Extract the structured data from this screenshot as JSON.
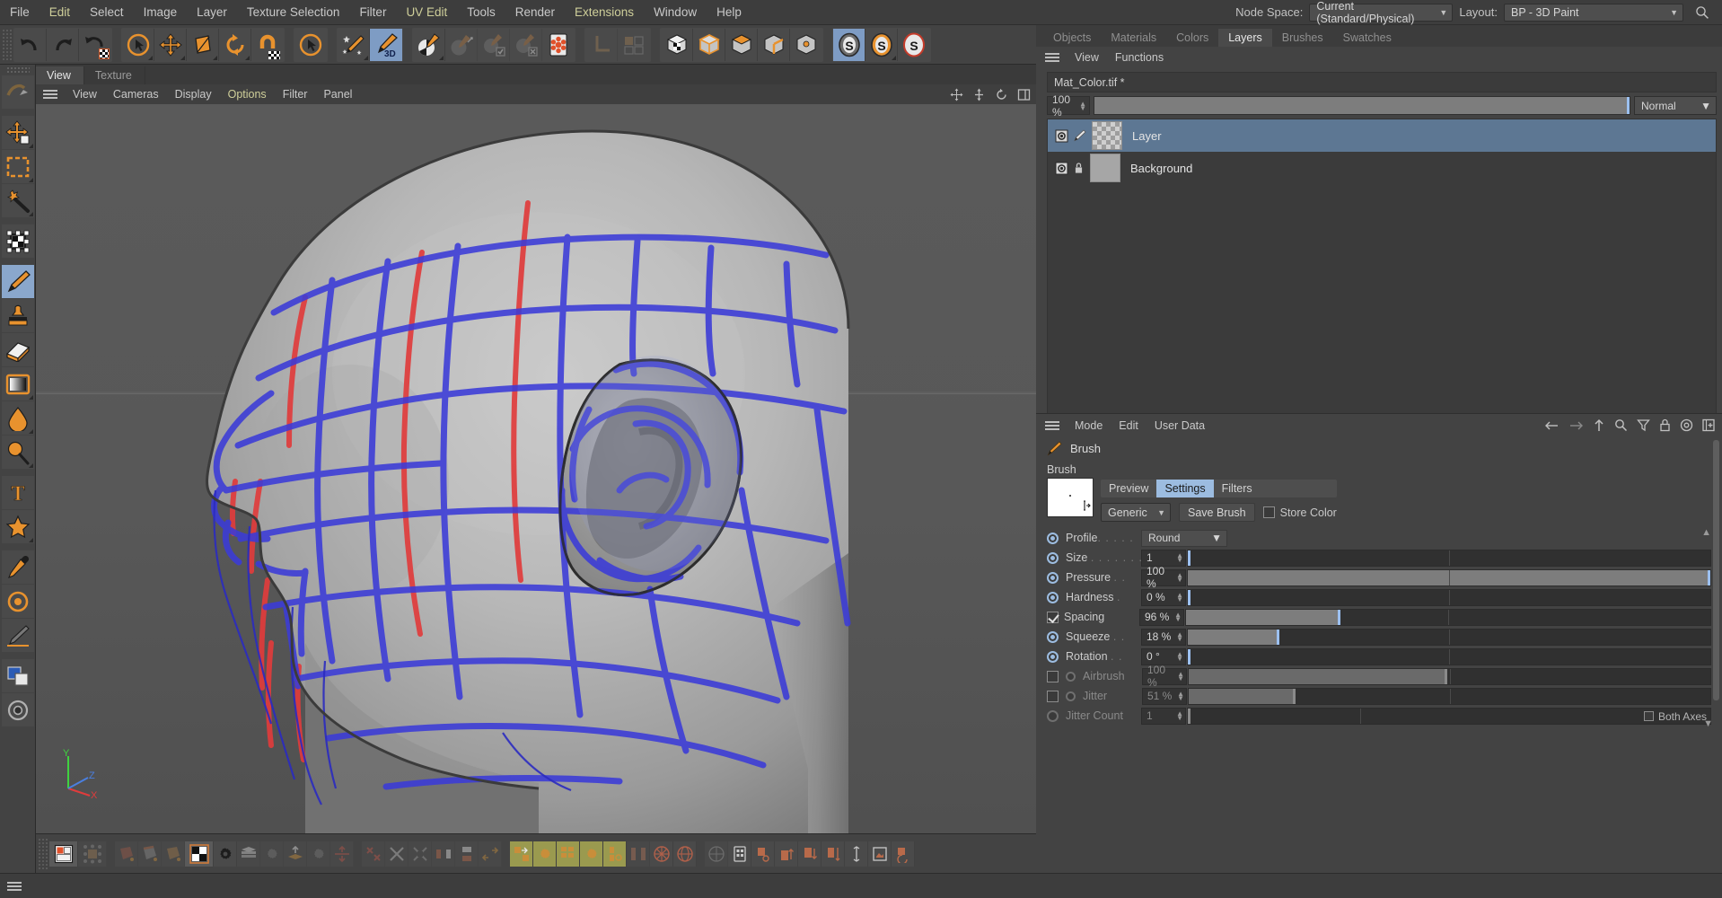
{
  "app": {
    "title": "BodyPaint 3D / Cinema 4D"
  },
  "menubar": {
    "items": [
      {
        "label": "File",
        "highlight": false
      },
      {
        "label": "Edit",
        "highlight": true
      },
      {
        "label": "Select",
        "highlight": false
      },
      {
        "label": "Image",
        "highlight": false
      },
      {
        "label": "Layer",
        "highlight": false
      },
      {
        "label": "Texture Selection",
        "highlight": false
      },
      {
        "label": "Filter",
        "highlight": false
      },
      {
        "label": "UV Edit",
        "highlight": true
      },
      {
        "label": "Tools",
        "highlight": false
      },
      {
        "label": "Render",
        "highlight": false
      },
      {
        "label": "Extensions",
        "highlight": true
      },
      {
        "label": "Window",
        "highlight": false
      },
      {
        "label": "Help",
        "highlight": false
      }
    ],
    "node_space_label": "Node Space:",
    "node_space_value": "Current (Standard/Physical)",
    "layout_label": "Layout:",
    "layout_value": "BP - 3D Paint",
    "search_icon": "search-icon"
  },
  "toolbar": {
    "groups": [
      {
        "name": "undo-redo-group",
        "buttons": [
          {
            "name": "undo-button",
            "icon": "undo-arrow-icon",
            "state": "normal"
          },
          {
            "name": "redo-button",
            "icon": "redo-arrow-icon",
            "state": "normal"
          },
          {
            "name": "undo-texture-button",
            "icon": "undo-texture-icon",
            "state": "normal"
          }
        ]
      },
      {
        "name": "transform-group",
        "buttons": [
          {
            "name": "selection-tool-button",
            "icon": "cursor-circle-icon",
            "state": "normal"
          },
          {
            "name": "move-tool-button",
            "icon": "move-cross-icon",
            "state": "normal"
          },
          {
            "name": "scale-tool-button",
            "icon": "scale-box-icon",
            "state": "normal"
          },
          {
            "name": "rotate-tool-button",
            "icon": "rotate-circle-icon",
            "state": "normal"
          },
          {
            "name": "snap-button",
            "icon": "magnet-icon",
            "state": "normal"
          }
        ]
      },
      {
        "name": "uv-group",
        "buttons": [
          {
            "name": "uv-selection-button",
            "icon": "cursor-circle-icon",
            "state": "normal"
          }
        ]
      },
      {
        "name": "paint-group",
        "buttons": [
          {
            "name": "paint-setup-wizard-button",
            "icon": "brush-stars-icon",
            "state": "normal"
          },
          {
            "name": "paint-3d-toggle-button",
            "icon": "brush-3d-icon",
            "state": "active"
          }
        ]
      },
      {
        "name": "texture-group",
        "buttons": [
          {
            "name": "texture-paint-button",
            "icon": "sphere-brush-icon",
            "state": "normal"
          },
          {
            "name": "projection-paint-button",
            "icon": "sphere-arrow-icon",
            "state": "disabled"
          },
          {
            "name": "apply-projection-button",
            "icon": "sphere-check-icon",
            "state": "disabled"
          },
          {
            "name": "cancel-projection-button",
            "icon": "sphere-x-icon",
            "state": "disabled"
          },
          {
            "name": "symmetry-button",
            "icon": "snowflake-icon",
            "state": "normal"
          }
        ]
      },
      {
        "name": "axis-group",
        "buttons": [
          {
            "name": "axis-button",
            "icon": "axis-L-icon",
            "state": "disabled"
          },
          {
            "name": "layout-button",
            "icon": "layout-squares-icon",
            "state": "disabled"
          }
        ]
      },
      {
        "name": "mode-group",
        "buttons": [
          {
            "name": "texture-mode-button",
            "icon": "cube-checker-icon",
            "state": "normal"
          },
          {
            "name": "model-mode-button",
            "icon": "cube-outline-icon",
            "state": "normal"
          },
          {
            "name": "polygon-mode-button",
            "icon": "cube-top-icon",
            "state": "normal"
          },
          {
            "name": "edge-mode-button",
            "icon": "cube-edge-icon",
            "state": "normal"
          },
          {
            "name": "point-mode-button",
            "icon": "cube-point-icon",
            "state": "normal"
          }
        ]
      },
      {
        "name": "cineman-group",
        "buttons": [
          {
            "name": "cineman-grey-button",
            "icon": "cineman-grey-icon",
            "state": "active"
          },
          {
            "name": "cineman-orange-button",
            "icon": "cineman-orange-icon",
            "state": "normal"
          },
          {
            "name": "cineman-red-button",
            "icon": "cineman-red-icon",
            "state": "normal"
          }
        ]
      }
    ]
  },
  "left_toolbar": {
    "buttons": [
      {
        "name": "tool-live-selection",
        "icon": "live-selection-icon",
        "state": "normal"
      },
      {
        "name": "tool-move",
        "icon": "move-arrows-icon",
        "state": "normal"
      },
      {
        "name": "tool-rect-selection",
        "icon": "rect-marquee-icon",
        "state": "normal"
      },
      {
        "name": "tool-magic-wand",
        "icon": "magic-wand-icon",
        "state": "normal"
      },
      {
        "name": "tool-texture-transform",
        "icon": "texture-transform-icon",
        "state": "normal"
      },
      {
        "name": "tool-brush",
        "icon": "paint-brush-icon",
        "state": "active"
      },
      {
        "name": "tool-clone",
        "icon": "clone-stamp-icon",
        "state": "normal"
      },
      {
        "name": "tool-eraser",
        "icon": "eraser-icon",
        "state": "normal"
      },
      {
        "name": "tool-gradient",
        "icon": "gradient-icon",
        "state": "normal"
      },
      {
        "name": "tool-fill",
        "icon": "fill-drop-icon",
        "state": "normal"
      },
      {
        "name": "tool-blur",
        "icon": "blur-magnifier-icon",
        "state": "normal"
      },
      {
        "name": "tool-text",
        "icon": "text-T-icon",
        "state": "normal"
      },
      {
        "name": "tool-shape",
        "icon": "star-shape-icon",
        "state": "normal"
      },
      {
        "name": "tool-color-picker",
        "icon": "eyedropper-icon",
        "state": "normal"
      },
      {
        "name": "tool-color-wheel",
        "icon": "color-wheel-icon",
        "state": "normal"
      },
      {
        "name": "tool-line",
        "icon": "line-pen-icon",
        "state": "normal"
      },
      {
        "name": "tool-swatch",
        "icon": "fg-bg-color-icon",
        "state": "normal"
      },
      {
        "name": "tool-fill-mode",
        "icon": "circle-mode-icon",
        "state": "normal"
      }
    ]
  },
  "viewport": {
    "tabs": [
      {
        "label": "View",
        "selected": true
      },
      {
        "label": "Texture",
        "selected": false
      }
    ],
    "menus": [
      {
        "label": "View",
        "highlight": false
      },
      {
        "label": "Cameras",
        "highlight": false
      },
      {
        "label": "Display",
        "highlight": false
      },
      {
        "label": "Options",
        "highlight": true
      },
      {
        "label": "Filter",
        "highlight": false
      },
      {
        "label": "Panel",
        "highlight": false
      }
    ],
    "right_icons": [
      {
        "name": "pan-icon"
      },
      {
        "name": "dolly-icon"
      },
      {
        "name": "rotate-view-icon"
      },
      {
        "name": "maximize-view-icon"
      }
    ],
    "axis_gizmo": {
      "x": "X",
      "y": "Y",
      "z": "Z"
    },
    "content_description": "3D head model in side view with blue and red UV wireframe overlay"
  },
  "bottom_toolbar": {
    "groups": [
      {
        "name": "display-group",
        "buttons": [
          {
            "name": "uv-mesh-display-button",
            "icon": "uv-display-icon",
            "state": "sel"
          },
          {
            "name": "uv-mesh-edit-button",
            "icon": "uv-edit-icon",
            "state": "dis"
          }
        ]
      },
      {
        "name": "paint-mode-group",
        "buttons": [
          {
            "name": "paint-polygon-button",
            "icon": "paint-poly-icon",
            "state": "dis"
          },
          {
            "name": "paint-edge-button",
            "icon": "paint-edge-icon",
            "state": "dis"
          },
          {
            "name": "paint-point-button",
            "icon": "paint-point-icon",
            "state": "dis"
          },
          {
            "name": "uv-checker-button",
            "icon": "uv-checker-icon",
            "state": "sel"
          },
          {
            "name": "uv-checker-settings-button",
            "icon": "gear-icon",
            "state": "normal"
          },
          {
            "name": "uv-layers-button",
            "icon": "uv-layers-icon",
            "state": "dis"
          },
          {
            "name": "uv-layers-settings-button",
            "icon": "gear-icon",
            "state": "dis"
          },
          {
            "name": "uv-unfold-button",
            "icon": "uv-unfold-icon",
            "state": "dis"
          },
          {
            "name": "uv-unfold-settings-button",
            "icon": "gear-icon",
            "state": "dis"
          },
          {
            "name": "uv-align-button",
            "icon": "uv-align-icon",
            "state": "dis"
          }
        ]
      },
      {
        "name": "uv-command-group",
        "buttons": [
          {
            "name": "uv-flip-button",
            "icon": "uv-flip-icon",
            "state": "dis"
          },
          {
            "name": "uv-transfer-button",
            "icon": "uv-transfer-icon",
            "state": "dis"
          },
          {
            "name": "uv-copy-button",
            "icon": "uv-copy-icon",
            "state": "dis"
          },
          {
            "name": "uv-mirror-u-button",
            "icon": "mirror-u-icon",
            "state": "dis"
          },
          {
            "name": "uv-mirror-v-button",
            "icon": "mirror-v-icon",
            "state": "dis"
          },
          {
            "name": "uv-mirror-uv-button",
            "icon": "mirror-uv-icon",
            "state": "dis"
          }
        ]
      },
      {
        "name": "uv-layout-group",
        "buttons": [
          {
            "name": "uv-split-button",
            "icon": "uv-split-icon",
            "state": "dis"
          },
          {
            "name": "uv-stack-button",
            "icon": "uv-stack-icon",
            "state": "dis"
          },
          {
            "name": "uv-pack-button",
            "icon": "uv-pack-icon",
            "state": "dis"
          },
          {
            "name": "uv-relax-button",
            "icon": "uv-relax-icon",
            "state": "olive"
          },
          {
            "name": "uv-relax-settings-button",
            "icon": "gear-icon",
            "state": "olive"
          },
          {
            "name": "uv-grid-button",
            "icon": "uv-grid-icon",
            "state": "olive"
          },
          {
            "name": "uv-grid-settings-button",
            "icon": "gear-icon",
            "state": "olive"
          },
          {
            "name": "uv-optimal-button",
            "icon": "uv-optimal-icon",
            "state": "olive"
          },
          {
            "name": "uv-realign-button",
            "icon": "uv-realign-icon",
            "state": "normal"
          },
          {
            "name": "uv-sphere-map-button",
            "icon": "uv-sphere-map-icon",
            "state": "normal"
          },
          {
            "name": "uv-box-map-button",
            "icon": "uv-box-map-icon",
            "state": "normal"
          }
        ]
      },
      {
        "name": "uv-misc-group",
        "buttons": [
          {
            "name": "uv-mesh-button",
            "icon": "uv-mesh-icon",
            "state": "normal"
          },
          {
            "name": "uv-texture-button",
            "icon": "uv-texture-icon",
            "state": "normal"
          },
          {
            "name": "uv-move-button",
            "icon": "uv-move-icon",
            "state": "normal"
          },
          {
            "name": "uv-up-button",
            "icon": "uv-up-icon",
            "state": "normal"
          },
          {
            "name": "uv-down-button",
            "icon": "uv-down-icon",
            "state": "normal"
          },
          {
            "name": "uv-distribute-button",
            "icon": "uv-distribute-icon",
            "state": "normal"
          },
          {
            "name": "uv-scale-button",
            "icon": "uv-scale-icon",
            "state": "normal"
          },
          {
            "name": "uv-image-button",
            "icon": "uv-image-icon",
            "state": "normal"
          },
          {
            "name": "uv-rotate-button",
            "icon": "uv-rotate-icon",
            "state": "normal"
          }
        ]
      }
    ]
  },
  "right_dock": {
    "tabs": [
      {
        "label": "Objects",
        "selected": false
      },
      {
        "label": "Materials",
        "selected": false
      },
      {
        "label": "Colors",
        "selected": false
      },
      {
        "label": "Layers",
        "selected": true
      },
      {
        "label": "Brushes",
        "selected": false
      },
      {
        "label": "Swatches",
        "selected": false
      }
    ],
    "menus": [
      {
        "label": "View"
      },
      {
        "label": "Functions"
      }
    ],
    "document_name": "Mat_Color.tif *",
    "opacity_value": "100 %",
    "blend_mode": "Normal",
    "layers": [
      {
        "name": "Layer",
        "selected": true,
        "thumb": "checker",
        "visible_icon": "eye-icon",
        "second_icon": "brush-icon"
      },
      {
        "name": "Background",
        "selected": false,
        "thumb": "gray",
        "visible_icon": "eye-icon",
        "second_icon": "lock-icon"
      }
    ]
  },
  "attribute_manager": {
    "menus": [
      {
        "label": "Mode"
      },
      {
        "label": "Edit"
      },
      {
        "label": "User Data"
      }
    ],
    "right_icons": [
      {
        "name": "back-arrow-icon"
      },
      {
        "name": "forward-arrow-icon"
      },
      {
        "name": "up-arrow-icon"
      },
      {
        "name": "search-icon"
      },
      {
        "name": "filter-funnel-icon"
      },
      {
        "name": "lock-icon"
      },
      {
        "name": "target-icon"
      },
      {
        "name": "add-panel-icon"
      }
    ],
    "object_icon": "brush-icon",
    "object_name": "Brush",
    "section_title": "Brush",
    "tabs": [
      {
        "label": "Preview",
        "selected": false
      },
      {
        "label": "Settings",
        "selected": true
      },
      {
        "label": "Filters",
        "selected": false
      }
    ],
    "preset_combo": "Generic",
    "save_brush_label": "Save Brush",
    "store_color_label": "Store Color",
    "store_color_checked": false,
    "params": [
      {
        "name": "profile",
        "label": "Profile",
        "dots": ". . . . .",
        "radio": "on",
        "type": "combo",
        "value": "Round",
        "enabled": true
      },
      {
        "name": "size",
        "label": "Size",
        "dots": ". . . . . . .",
        "radio": "on",
        "type": "slider",
        "value": "1",
        "fill_pct": 0,
        "knob_pct": 0,
        "enabled": true
      },
      {
        "name": "pressure",
        "label": "Pressure",
        "dots": ". .",
        "radio": "on",
        "type": "slider",
        "value": "100 %",
        "fill_pct": 100,
        "knob_pct": 100,
        "enabled": true
      },
      {
        "name": "hardness",
        "label": "Hardness",
        "dots": " .",
        "radio": "on",
        "type": "slider",
        "value": "0 %",
        "fill_pct": 0,
        "knob_pct": 0,
        "enabled": true
      },
      {
        "name": "spacing",
        "label": "Spacing",
        "dots": "",
        "radio": "check-on",
        "type": "slider",
        "value": "96 %",
        "fill_pct": 29,
        "knob_pct": 29,
        "enabled": true
      },
      {
        "name": "squeeze",
        "label": "Squeeze",
        "dots": ". .",
        "radio": "on",
        "type": "slider",
        "value": "18 %",
        "fill_pct": 17,
        "knob_pct": 17,
        "enabled": true
      },
      {
        "name": "rotation",
        "label": "Rotation",
        "dots": ". .",
        "radio": "on",
        "type": "slider",
        "value": "0 °",
        "fill_pct": 0,
        "knob_pct": 0,
        "enabled": true
      },
      {
        "name": "airbrush",
        "label": "Airbrush",
        "dots": "",
        "radio": "check-off",
        "type": "slider",
        "value": "100 %",
        "fill_pct": 49,
        "knob_pct": 49,
        "enabled": false
      },
      {
        "name": "jitter",
        "label": "Jitter",
        "dots": "",
        "radio": "check-off",
        "type": "slider",
        "value": "51 %",
        "fill_pct": 20,
        "knob_pct": 20,
        "enabled": false
      },
      {
        "name": "jitter_count",
        "label": "Jitter Count",
        "dots": "",
        "radio": "off",
        "type": "slider",
        "value": "1",
        "fill_pct": 0,
        "knob_pct": 0,
        "enabled": false
      }
    ],
    "both_axes_label": "Both Axes",
    "both_axes_checked": false
  },
  "colors": {
    "accent_blue": "#9cbce0",
    "selection_blue": "#5d7793",
    "orange": "#e8922e",
    "panel_bg": "#434343",
    "dark_bg": "#3a3a3a",
    "olive": "#9a9a4f",
    "uv_blue": "#3333dd",
    "uv_red": "#e04040"
  }
}
